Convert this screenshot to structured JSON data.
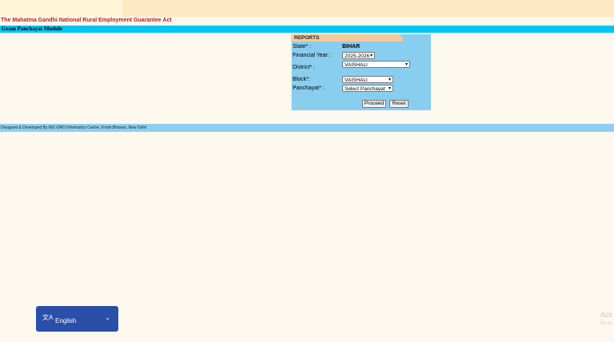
{
  "header": {
    "app_title": "The Mahatma Gandhi National Rural Employment Guarantee Act",
    "module": "Gram Panchayat Module"
  },
  "reports": {
    "tab_label": "REPORTS",
    "state_label": "State* :",
    "state_value": "BIHAR",
    "fy_label": "Financial Year :",
    "fy_value": "2025-2026",
    "district_label": "District* :",
    "district_value": "VAISHALI",
    "block_label": "Block*:",
    "block_value": "VAISHALI",
    "panchayat_label": "Panchayat* :",
    "panchayat_value": "Select Panchayat",
    "proceed": "Proceed",
    "reset": "Reset"
  },
  "footer": {
    "text": "Designed & Developed By NIC-DRD Informatics Centre, Krishi Bhavan, New Delhi"
  },
  "language": {
    "label": "English",
    "icon": "translate-icon"
  },
  "watermark": {
    "line1": "Acti",
    "line2": "Go to"
  }
}
